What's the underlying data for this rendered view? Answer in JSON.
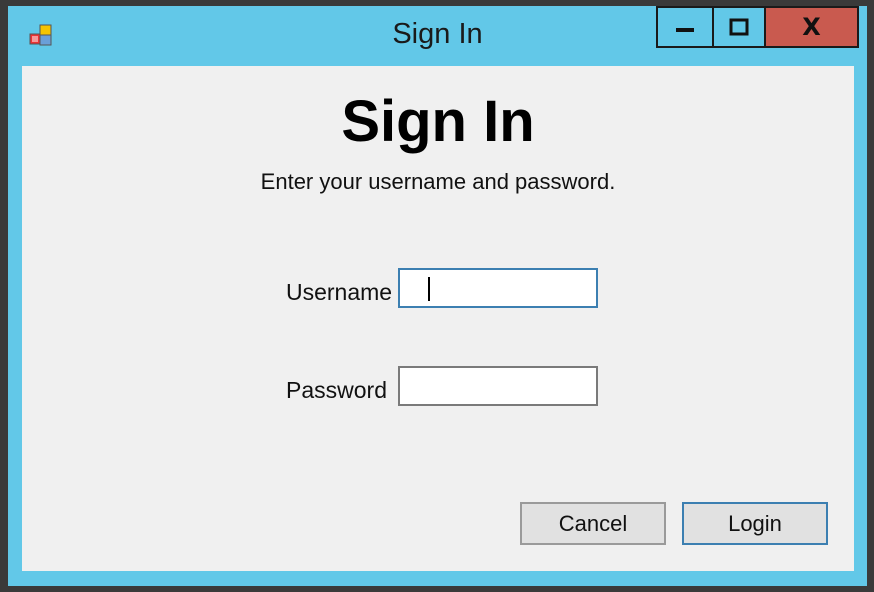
{
  "window": {
    "title": "Sign In",
    "controls": {
      "minimize_icon": "minimize-icon",
      "maximize_icon": "maximize-icon",
      "close_icon": "close-icon",
      "close_glyph": "X"
    },
    "colors": {
      "frame": "#62c8e8",
      "close": "#c95a4f",
      "client": "#f0f0f0",
      "focus_border": "#3c7fb1"
    }
  },
  "form": {
    "heading": "Sign In",
    "subtitle": "Enter your username and password.",
    "username_label": "Username",
    "username_value": "",
    "password_label": "Password",
    "password_value": "",
    "cancel_label": "Cancel",
    "login_label": "Login"
  }
}
